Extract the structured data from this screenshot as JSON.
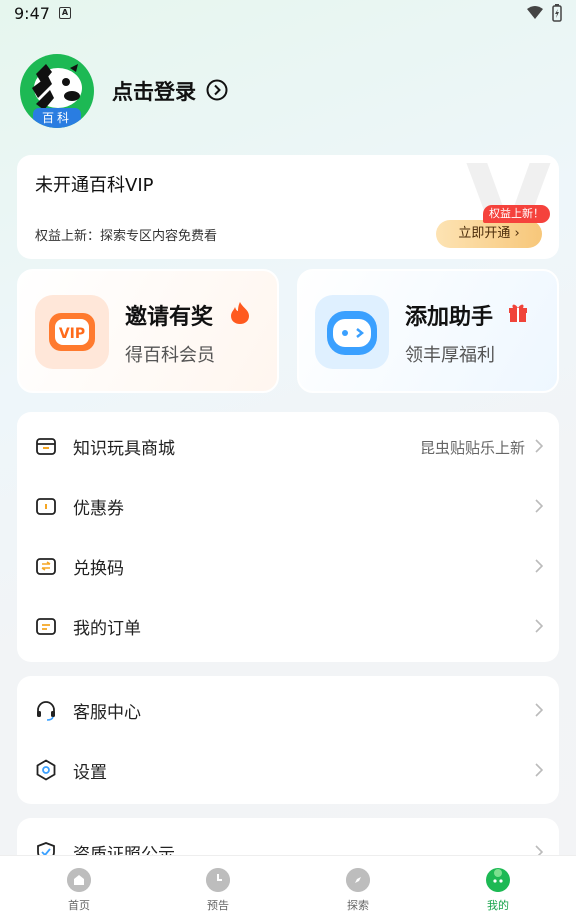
{
  "status_bar": {
    "time": "9:47",
    "notif_letter": "A"
  },
  "profile": {
    "avatar_badge": "百科",
    "login_text": "点击登录"
  },
  "vip_card": {
    "title": "未开通百科VIP",
    "desc": "权益上新：探索专区内容免费看",
    "button_label": "立即开通",
    "tag": "权益上新！"
  },
  "promos": [
    {
      "title": "邀请有奖",
      "sub": "得百科会员",
      "icon": "vip-icon",
      "badge_icon": "fire-icon"
    },
    {
      "title": "添加助手",
      "sub": "领丰厚福利",
      "icon": "robot-icon",
      "badge_icon": "gift-icon"
    }
  ],
  "menu_group_1": [
    {
      "label": "知识玩具商城",
      "extra": "昆虫贴贴乐上新",
      "icon": "shop-icon"
    },
    {
      "label": "优惠券",
      "extra": "",
      "icon": "coupon-icon"
    },
    {
      "label": "兑换码",
      "extra": "",
      "icon": "exchange-icon"
    },
    {
      "label": "我的订单",
      "extra": "",
      "icon": "order-icon"
    }
  ],
  "menu_group_2": [
    {
      "label": "客服中心",
      "icon": "headset-icon"
    },
    {
      "label": "设置",
      "icon": "settings-icon"
    }
  ],
  "menu_group_3": [
    {
      "label": "资质证照公示",
      "icon": "certificate-icon"
    }
  ],
  "tabs": [
    {
      "label": "首页",
      "icon": "home-icon",
      "active": false
    },
    {
      "label": "预告",
      "icon": "clock-icon",
      "active": false
    },
    {
      "label": "探索",
      "icon": "compass-icon",
      "active": false
    },
    {
      "label": "我的",
      "icon": "profile-icon",
      "active": true
    }
  ],
  "colors": {
    "accent": "#1db954",
    "tag_red": "#f5423c",
    "vip_gold": "#f7c77a"
  }
}
